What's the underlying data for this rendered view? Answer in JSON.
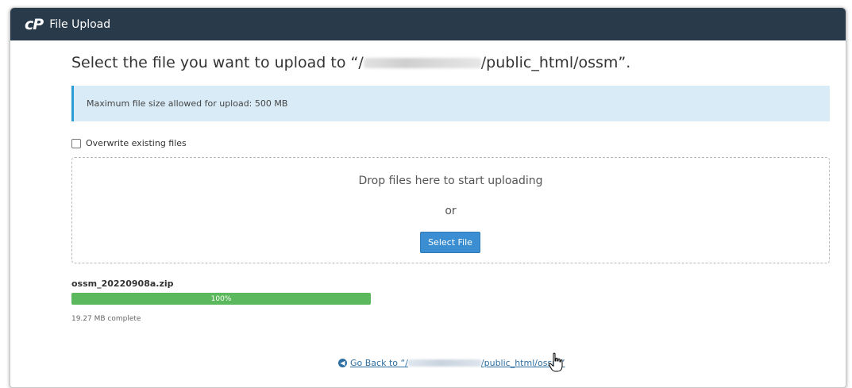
{
  "window": {
    "logo": "cP",
    "title": "File Upload"
  },
  "upload": {
    "heading_prefix": "Select the file you want to upload to “/",
    "heading_suffix": "/public_html/ossm”.",
    "max_size_notice": "Maximum file size allowed for upload: 500 MB",
    "overwrite_label": "Overwrite existing files",
    "overwrite_checked": false
  },
  "dropzone": {
    "text": "Drop files here to start uploading",
    "or": "or",
    "select_button": "Select File"
  },
  "file": {
    "name": "ossm_20220908a.zip",
    "progress_label": "100%",
    "progress_fraction": 1.0,
    "status": "19.27 MB complete"
  },
  "footer": {
    "back_prefix": "Go Back to “/",
    "back_suffix": "/public_html/ossm”"
  },
  "colors": {
    "titlebar": "#293a4a",
    "info_bg": "#d8ebf7",
    "info_accent": "#2d9bd4",
    "button": "#3a8ed1",
    "progress": "#5cb85c",
    "link": "#2d6fa3"
  },
  "icons": {
    "back": "circle-arrow-left-icon",
    "cursor": "hand-pointer-icon"
  }
}
